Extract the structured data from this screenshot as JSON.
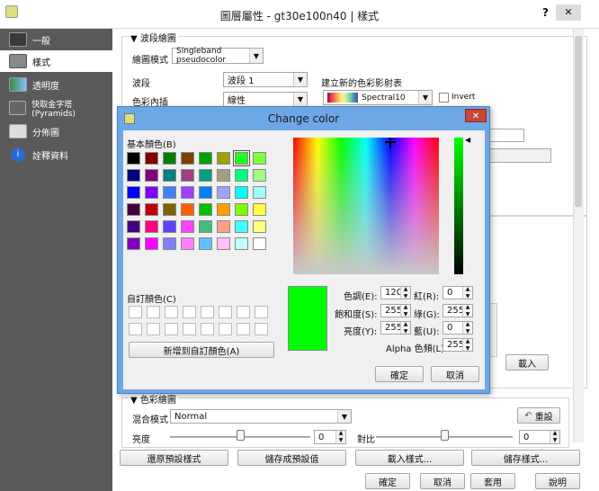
{
  "window": {
    "title": "圖層屬性 - gt30e100n40 | 樣式",
    "help": "?",
    "close": "✕"
  },
  "sidebar": {
    "items": [
      {
        "label": "一般",
        "icon": "tools-icon"
      },
      {
        "label": "樣式",
        "icon": "brush-icon"
      },
      {
        "label": "透明度",
        "icon": "transparency-icon"
      },
      {
        "label": "快取金字塔(Pyramids)",
        "icon": "pyramid-icon"
      },
      {
        "label": "分佈圖",
        "icon": "histogram-icon"
      },
      {
        "label": "詮釋資料",
        "icon": "info-icon"
      }
    ]
  },
  "band": {
    "section": "波段繪圖",
    "render_type_label": "繪圖模式",
    "render_type": "Singleband pseudocolor",
    "band_label": "波段",
    "band_value": "波段 1",
    "interp_label": "色彩內插",
    "interp_value": "線性",
    "ramp_label": "建立新的色彩影射表",
    "ramp_value": "Spectral10",
    "invert_label": "Invert"
  },
  "load_button": "載入",
  "color_render": {
    "section": "色彩繪圖",
    "blend_label": "混合模式",
    "blend_value": "Normal",
    "reset_label": "重設",
    "brightness_label": "亮度",
    "brightness_value": "0",
    "contrast_label": "對比",
    "contrast_value": "0"
  },
  "footer": {
    "restore": "還原預設樣式",
    "save_default": "儲存成預設值",
    "load_style": "載入樣式...",
    "save_style": "儲存樣式...",
    "ok": "確定",
    "cancel": "取消",
    "apply": "套用",
    "help": "說明"
  },
  "dialog": {
    "title": "Change color",
    "basic_label": "基本顏色(B)",
    "custom_label": "自訂顏色(C)",
    "add_custom": "新增到自訂顏色(A)",
    "hue_label": "色調(E):",
    "hue": "120",
    "sat_label": "飽和度(S):",
    "sat": "255",
    "val_label": "亮度(Y):",
    "val": "255",
    "red_label": "紅(R):",
    "red": "0",
    "green_label": "綠(G):",
    "green": "255",
    "blue_label": "藍(U):",
    "blue": "0",
    "alpha_label": "Alpha 色頻(L):",
    "alpha": "255",
    "ok": "確定",
    "cancel": "取消",
    "current_color": "#00ff00",
    "basic_colors": [
      "#000000",
      "#800000",
      "#008000",
      "#804000",
      "#00a000",
      "#a0a000",
      "#20ff20",
      "#80ff40",
      "#000080",
      "#800080",
      "#008080",
      "#a04080",
      "#00a080",
      "#a0a080",
      "#00ff80",
      "#a0ff80",
      "#0000ff",
      "#8000ff",
      "#4080ff",
      "#a040ff",
      "#0080ff",
      "#a0a0ff",
      "#00ffff",
      "#a0ffff",
      "#400040",
      "#c00000",
      "#806000",
      "#ff6000",
      "#00c000",
      "#ffa000",
      "#80ff00",
      "#ffff40",
      "#400080",
      "#ff0080",
      "#6040ff",
      "#ff40ff",
      "#40c080",
      "#ffa080",
      "#40ffff",
      "#ffff80",
      "#8000c0",
      "#ff00ff",
      "#8080ff",
      "#ff80ff",
      "#60c0ff",
      "#ffc0ff",
      "#c0ffff",
      "#ffffff"
    ]
  }
}
